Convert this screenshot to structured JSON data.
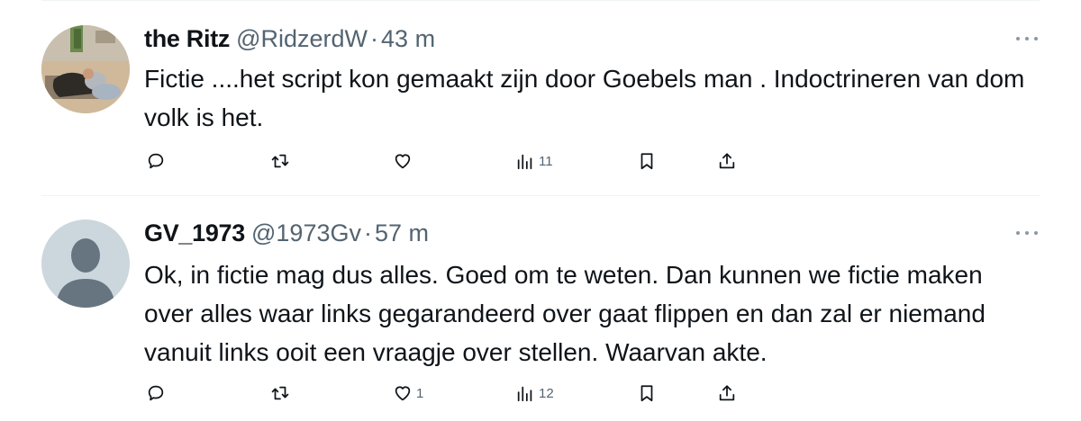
{
  "tweets": [
    {
      "display_name": "the Ritz",
      "handle": "@RidzerdW",
      "separator": "·",
      "time": "43 m",
      "text": "Fictie ....het script kon gemaakt zijn door Goebels man . Indoctrineren van dom volk is het.",
      "avatar": "photo-avatar",
      "actions": {
        "reply": {
          "icon": "reply-icon",
          "count": ""
        },
        "retweet": {
          "icon": "retweet-icon",
          "count": ""
        },
        "like": {
          "icon": "heart-icon",
          "count": ""
        },
        "views": {
          "icon": "views-icon",
          "count": "11"
        },
        "bookmark": {
          "icon": "bookmark-icon",
          "count": ""
        },
        "share": {
          "icon": "share-icon",
          "count": ""
        }
      }
    },
    {
      "display_name": "GV_1973",
      "handle": "@1973Gv",
      "separator": "·",
      "time": "57 m",
      "text": "Ok, in fictie mag dus alles. Goed om te weten. Dan kunnen we fictie maken over alles waar links gegarandeerd over gaat flippen en dan zal er niemand vanuit links ooit een vraagje over stellen. Waarvan akte.",
      "avatar": "default-avatar",
      "actions": {
        "reply": {
          "icon": "reply-icon",
          "count": ""
        },
        "retweet": {
          "icon": "retweet-icon",
          "count": ""
        },
        "like": {
          "icon": "heart-icon",
          "count": "1"
        },
        "views": {
          "icon": "views-icon",
          "count": "12"
        },
        "bookmark": {
          "icon": "bookmark-icon",
          "count": ""
        },
        "share": {
          "icon": "share-icon",
          "count": ""
        }
      }
    }
  ],
  "colors": {
    "text": "#0f1419",
    "secondary": "#536471",
    "divider": "#eff3f4",
    "default_avatar_bg": "#ccd6dd",
    "default_avatar_fg": "#66757f"
  }
}
